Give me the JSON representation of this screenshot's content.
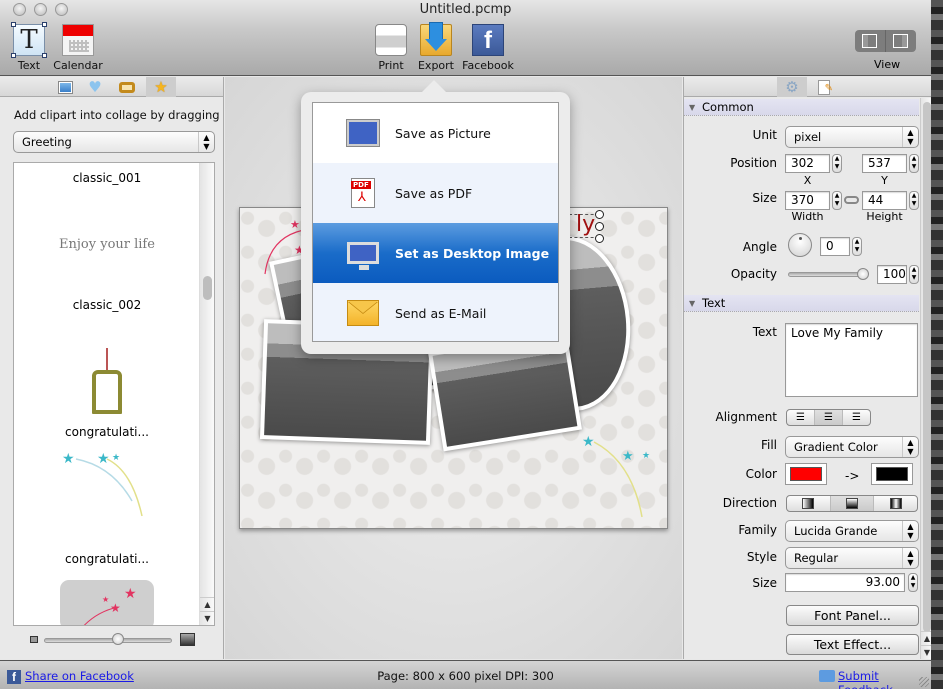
{
  "window": {
    "title": "Untitled.pcmp"
  },
  "toolbar": {
    "left": [
      {
        "id": "text",
        "label": "Text",
        "icon": "text-tool-icon"
      },
      {
        "id": "calendar",
        "label": "Calendar",
        "icon": "calendar-icon"
      }
    ],
    "center": [
      {
        "id": "print",
        "label": "Print",
        "icon": "printer-icon"
      },
      {
        "id": "export",
        "label": "Export",
        "icon": "export-folder-icon"
      },
      {
        "id": "facebook",
        "label": "Facebook",
        "icon": "facebook-icon"
      }
    ],
    "view_label": "View"
  },
  "left_panel": {
    "tabs": [
      {
        "icon": "photo-icon"
      },
      {
        "icon": "heart-icon"
      },
      {
        "icon": "frame-icon"
      },
      {
        "icon": "star-icon",
        "active": true
      }
    ],
    "hint": "Add clipart into collage by dragging",
    "category": "Greeting",
    "items": [
      {
        "label": "classic_001",
        "preview_text": "Enjoy your life"
      },
      {
        "label": "classic_002"
      },
      {
        "label": "congratulati..."
      },
      {
        "label": "congratulati..."
      }
    ],
    "thumbnail_size": 0.55
  },
  "export_menu": {
    "items": [
      {
        "label": "Save as Picture",
        "icon": "picture-icon"
      },
      {
        "label": "Save as PDF",
        "icon": "pdf-icon"
      },
      {
        "label": "Set as Desktop Image",
        "icon": "desktop-icon",
        "selected": true
      },
      {
        "label": "Send as E-Mail",
        "icon": "mail-icon"
      }
    ]
  },
  "canvas": {
    "selected_text_visible": "ly"
  },
  "right_panel": {
    "tabs": [
      {
        "icon": "gear-icon",
        "active": true
      },
      {
        "icon": "edit-document-icon"
      }
    ],
    "common": {
      "title": "Common",
      "unit_label": "Unit",
      "unit": "pixel",
      "position_label": "Position",
      "x": "302",
      "y": "537",
      "x_label": "X",
      "y_label": "Y",
      "size_label": "Size",
      "width": "370",
      "height": "44",
      "width_label": "Width",
      "height_label": "Height",
      "angle_label": "Angle",
      "angle": "0",
      "opacity_label": "Opacity",
      "opacity": "100"
    },
    "text": {
      "title": "Text",
      "text_label": "Text",
      "text_value": "Love My Family",
      "alignment_label": "Alignment",
      "alignment_selected": "center",
      "fill_label": "Fill",
      "fill": "Gradient Color",
      "color_label": "Color",
      "color_from": "#ff0000",
      "color_to": "#000000",
      "arrow": "->",
      "direction_label": "Direction",
      "family_label": "Family",
      "family": "Lucida Grande",
      "style_label": "Style",
      "style": "Regular",
      "size_label": "Size",
      "size": "93.00",
      "font_panel_button": "Font Panel...",
      "text_effect_button": "Text Effect..."
    }
  },
  "status": {
    "share_link": "Share on Facebook",
    "page_info": "Page: 800 x 600 pixel DPI: 300",
    "feedback_link": "Submit Feedback"
  }
}
